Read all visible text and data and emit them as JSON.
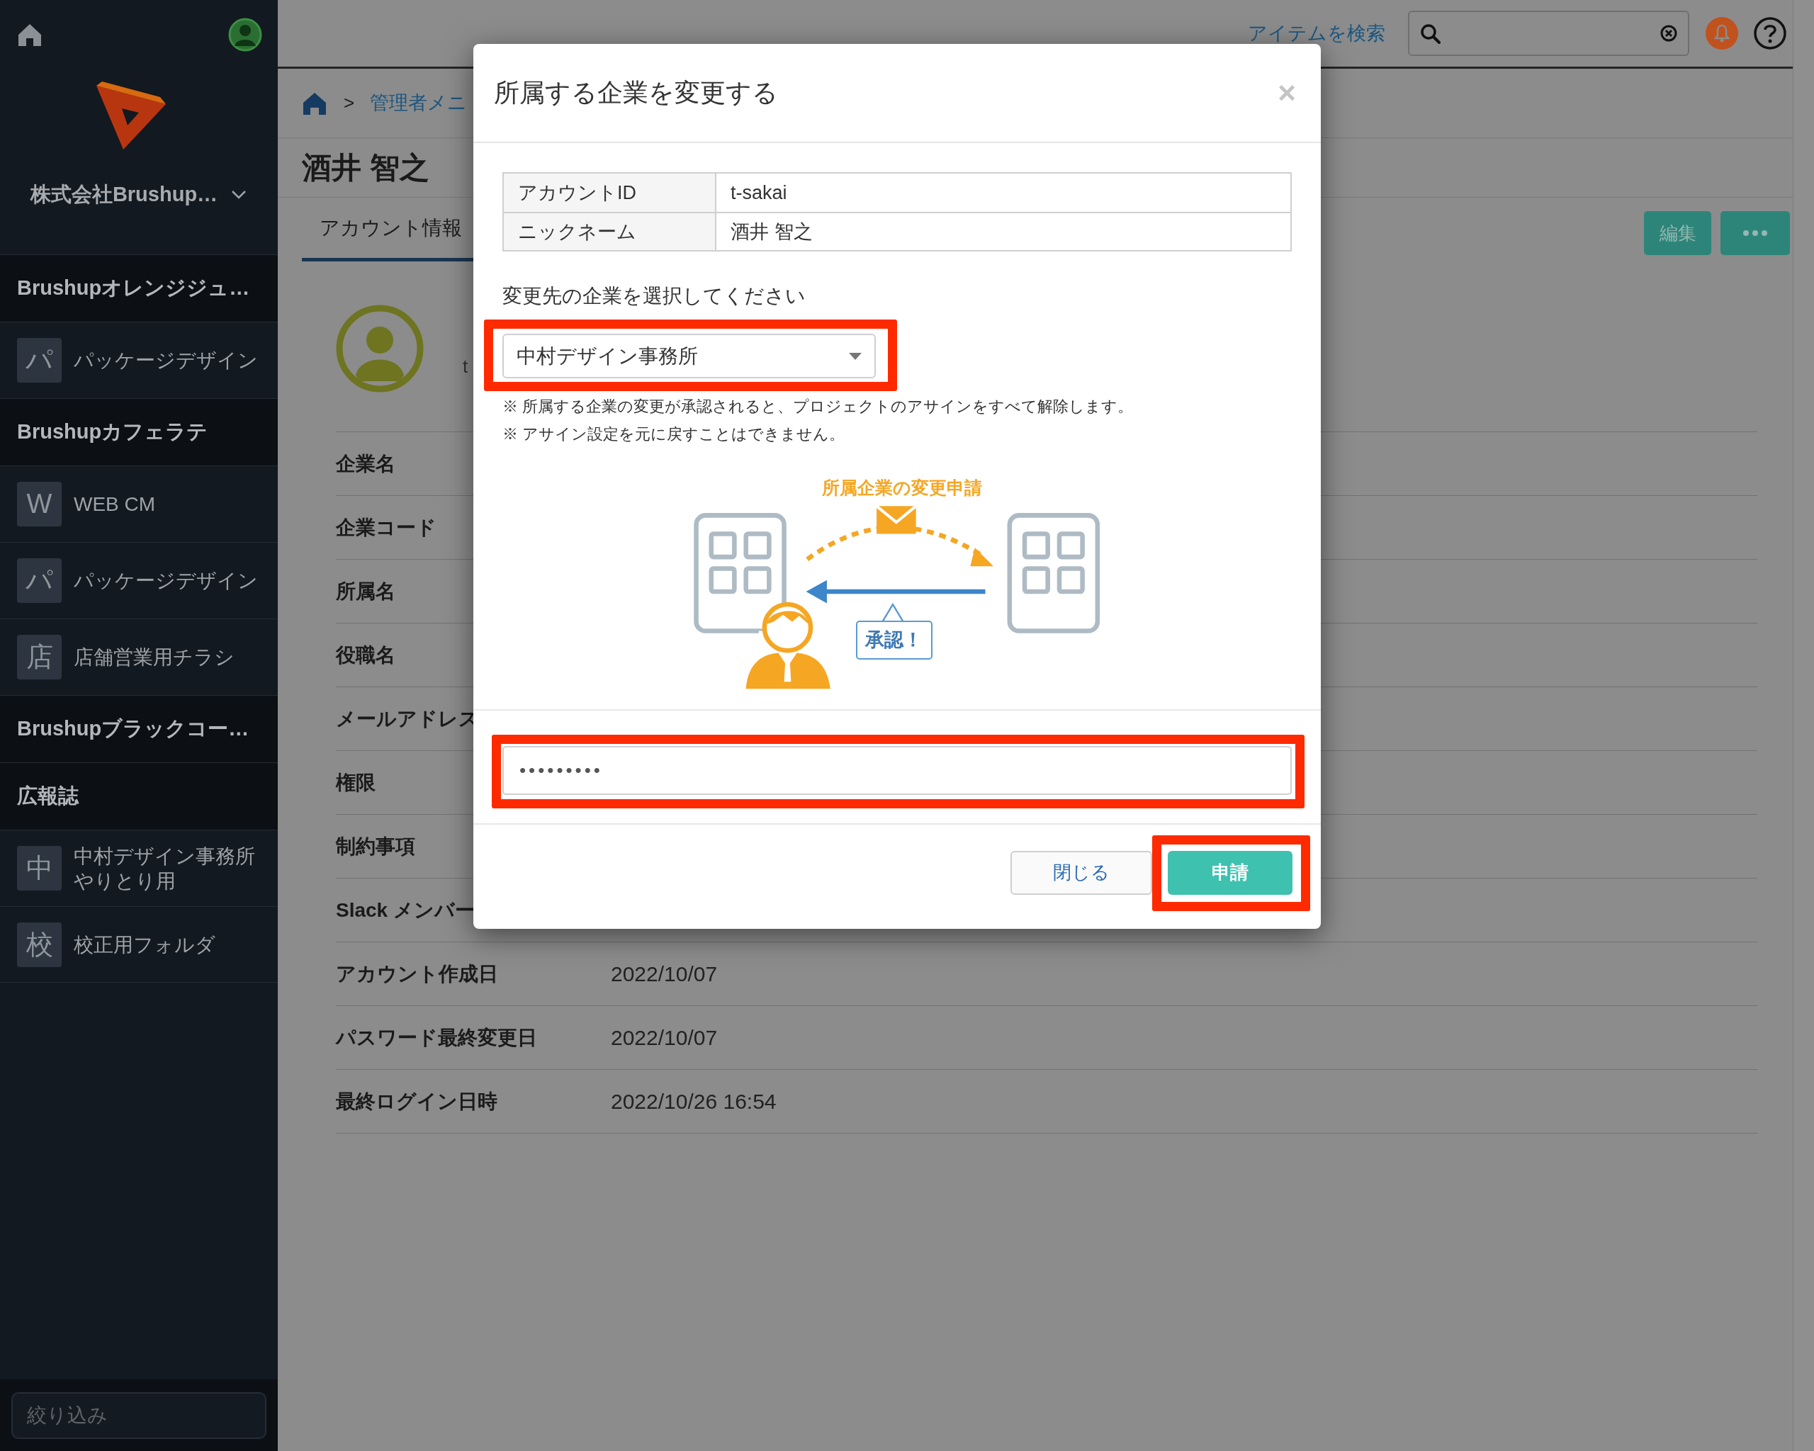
{
  "sidebar": {
    "company": "株式会社Brushup…",
    "groups": [
      {
        "name": "Brushupオレンジジュ…",
        "items": [
          {
            "icon": "パ",
            "label": "パッケージデザイン"
          }
        ]
      },
      {
        "name": "Brushupカフェラテ",
        "items": [
          {
            "icon": "W",
            "label": "WEB CM"
          },
          {
            "icon": "パ",
            "label": "パッケージデザイン"
          },
          {
            "icon": "店",
            "label": "店舗営業用チラシ"
          }
        ]
      },
      {
        "name": "Brushupブラックコー…"
      },
      {
        "name": "広報誌",
        "items": [
          {
            "icon": "中",
            "label": "中村デザイン事務所やりとり用"
          },
          {
            "icon": "校",
            "label": "校正用フォルダ"
          }
        ]
      }
    ],
    "filter": {
      "placeholder": "絞り込み"
    }
  },
  "header": {
    "search_link": "アイテムを検索"
  },
  "breadcrumb": {
    "separator": ">",
    "link": "管理者メニ"
  },
  "page": {
    "title": "酒井 智之",
    "tabs": [
      {
        "label": "アカウント情報",
        "selected": true
      }
    ],
    "edit_button": "編集"
  },
  "profile": {
    "account": "t"
  },
  "fields": [
    {
      "label": "企業名"
    },
    {
      "label": "企業コード"
    },
    {
      "label": "所属名"
    },
    {
      "label": "役職名"
    },
    {
      "label": "メールアドレス"
    },
    {
      "label": "権限"
    },
    {
      "label": "制約事項"
    },
    {
      "label": "Slack メンバー"
    },
    {
      "label": "アカウント作成日",
      "value": "2022/10/07"
    },
    {
      "label": "パスワード最終変更日",
      "value": "2022/10/07"
    },
    {
      "label": "最終ログイン日時",
      "value": "2022/10/26 16:54"
    }
  ],
  "modal": {
    "title": "所属する企業を変更する",
    "close": "×",
    "info": [
      {
        "label": "アカウントID",
        "value": "t-sakai"
      },
      {
        "label": "ニックネーム",
        "value": "酒井 智之"
      }
    ],
    "select_label": "変更先の企業を選択してください",
    "select": {
      "value": "中村デザイン事務所",
      "highlight": true
    },
    "notes": [
      "※ 所属する企業の変更が承認されると、プロジェクトのアサインをすべて解除します。",
      "※ アサイン設定を元に戻すことはできません。"
    ],
    "illustration_title": "所属企業の変更申請",
    "approval": "承認！",
    "password": {
      "value": "•••••••••",
      "highlight": true
    },
    "buttons": [
      {
        "label": "閉じる",
        "kind": "secondary",
        "highlight": false
      },
      {
        "label": "申請",
        "kind": "primary",
        "highlight": true
      }
    ]
  }
}
